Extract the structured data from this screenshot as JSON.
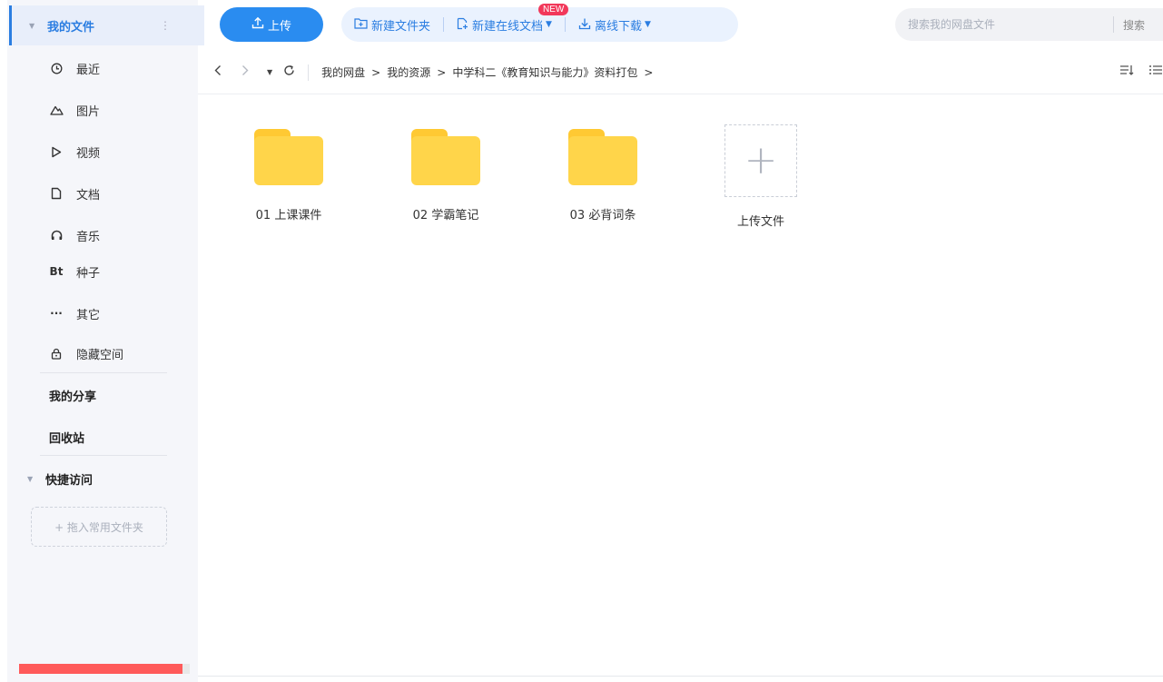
{
  "sidebar": {
    "my_files": "我的文件",
    "kebab": "⋮",
    "items": [
      {
        "label": "最近",
        "icon": "clock-icon",
        "glyph": "◷"
      },
      {
        "label": "图片",
        "icon": "image-icon",
        "glyph": "△"
      },
      {
        "label": "视频",
        "icon": "play-icon",
        "glyph": "▷"
      },
      {
        "label": "文档",
        "icon": "document-icon",
        "glyph": "▢"
      },
      {
        "label": "音乐",
        "icon": "headphone-icon",
        "glyph": "∩"
      },
      {
        "label": "种子",
        "icon": "bt-icon",
        "glyph": "Bt"
      },
      {
        "label": "其它",
        "icon": "more-icon",
        "glyph": "···"
      },
      {
        "label": "隐藏空间",
        "icon": "lock-icon",
        "glyph": "🔒"
      }
    ],
    "my_share": "我的分享",
    "recycle_bin": "回收站",
    "quick_access": "快捷访问",
    "drop_hint": "+ 拖入常用文件夹",
    "quota_fraction": 0.96,
    "quota_color": "#ff5a5a"
  },
  "toolbar": {
    "upload_label": "上传",
    "new_folder_label": "新建文件夹",
    "new_doc_label": "新建在线文档",
    "new_badge": "NEW",
    "offline_label": "离线下载",
    "search_placeholder": "搜索我的网盘文件",
    "search_button": "搜索"
  },
  "breadcrumb": {
    "items": [
      "我的网盘",
      "我的资源",
      "中学科二《教育知识与能力》资料打包"
    ],
    "arrow": ">"
  },
  "files": [
    {
      "name": "01 上课课件",
      "type": "folder"
    },
    {
      "name": "02 学霸笔记",
      "type": "folder"
    },
    {
      "name": "03 必背词条",
      "type": "folder"
    }
  ],
  "upload_tile": {
    "label": "上传文件",
    "glyph": "+"
  },
  "colors": {
    "accent": "#2a8cf0",
    "folder": "#ffd54a"
  }
}
